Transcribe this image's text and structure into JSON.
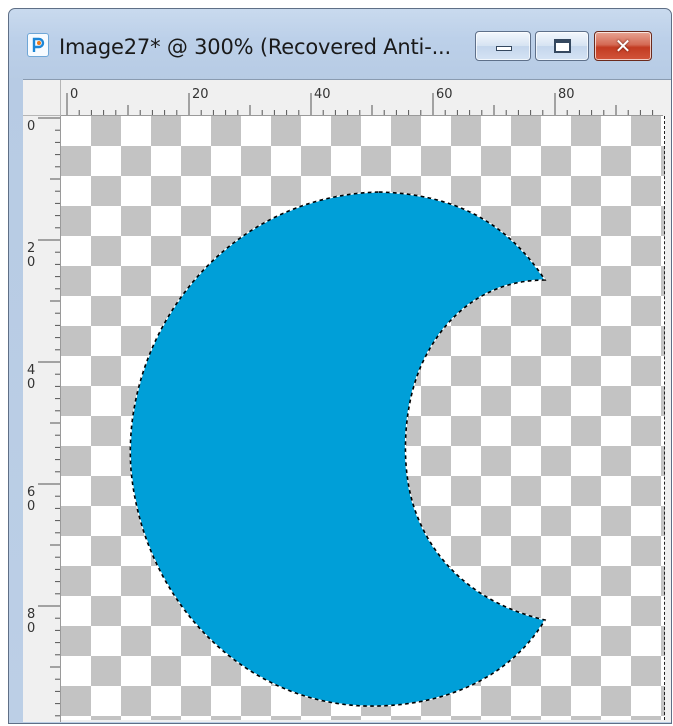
{
  "window": {
    "title": "Image27* @ 300% (Recovered Anti-...",
    "icon": "paintshop-pro-icon",
    "buttons": {
      "minimize": "minimize-icon",
      "maximize": "maximize-icon",
      "close": "close-icon"
    }
  },
  "rulers": {
    "horizontal_labels": [
      "0",
      "20",
      "40",
      "60",
      "80"
    ],
    "vertical_labels": [
      [
        "0"
      ],
      [
        "2",
        "0"
      ],
      [
        "4",
        "0"
      ],
      [
        "6",
        "0"
      ],
      [
        "8",
        "0"
      ]
    ]
  },
  "canvas": {
    "shape": "crescent-moon",
    "fill_color": "#009fd8",
    "checker_color": "#c3c3c3",
    "selection": "marching-ants"
  }
}
